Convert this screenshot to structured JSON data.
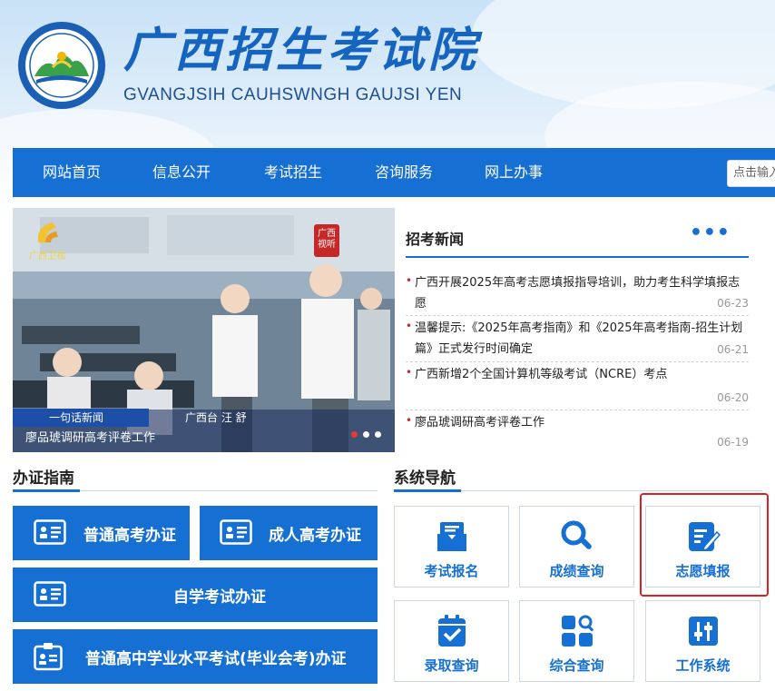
{
  "header": {
    "title": "广西招生考试院",
    "subtitle": "GVANGJSIH CAUHSWNGH GAUJSI YEN",
    "logo_text": "广西招生考试院",
    "logo_sub": "GVANGJSIH CAUHSWNGH GAUJSI YEN"
  },
  "nav": {
    "items": [
      "网站首页",
      "信息公开",
      "考试招生",
      "咨询服务",
      "网上办事"
    ],
    "search_placeholder": "点击输入"
  },
  "slider": {
    "channel_logo": "广西卫视",
    "badge_text": "广西视听",
    "caption_bar": "一句话新闻",
    "caption_reporter": "广西台  汪  舒",
    "caption": "廖品琥调研高考评卷工作",
    "active_slide": 1,
    "slide_count": 3
  },
  "news": {
    "title": "招考新闻",
    "more_icon": "more-dots-icon",
    "items": [
      {
        "text": "广西开展2025年高考志愿填报指导培训，助力考生科学填报志愿",
        "date": "06-23"
      },
      {
        "text": "温馨提示:《2025年高考指南》和《2025年高考指南-招生计划篇》正式发行时间确定",
        "date": "06-21"
      },
      {
        "text": "广西新增2个全国计算机等级考试（NCRE）考点",
        "date": "06-20"
      },
      {
        "text": "廖品琥调研高考评卷工作",
        "date": "06-19"
      }
    ]
  },
  "guide": {
    "title": "办证指南",
    "buttons": [
      {
        "label": "普通高考办证",
        "icon": "id-card-icon"
      },
      {
        "label": "成人高考办证",
        "icon": "id-card-icon"
      },
      {
        "label": "自学考试办证",
        "icon": "id-card-icon"
      },
      {
        "label": "普通高中学业水平考试(毕业会考)办证",
        "icon": "badge-card-icon"
      }
    ]
  },
  "system": {
    "title": "系统导航",
    "tiles": [
      {
        "label": "考试报名",
        "icon": "mailbox-icon"
      },
      {
        "label": "成绩查询",
        "icon": "search-icon"
      },
      {
        "label": "志愿填报",
        "icon": "edit-form-icon"
      },
      {
        "label": "录取查询",
        "icon": "clipboard-check-icon"
      },
      {
        "label": "综合查询",
        "icon": "grid-search-icon"
      },
      {
        "label": "工作系统",
        "icon": "sliders-icon"
      }
    ],
    "highlighted": "志愿填报"
  },
  "colors": {
    "primary": "#1670d3",
    "highlight": "#e02020",
    "news_dot": "#c62828"
  }
}
